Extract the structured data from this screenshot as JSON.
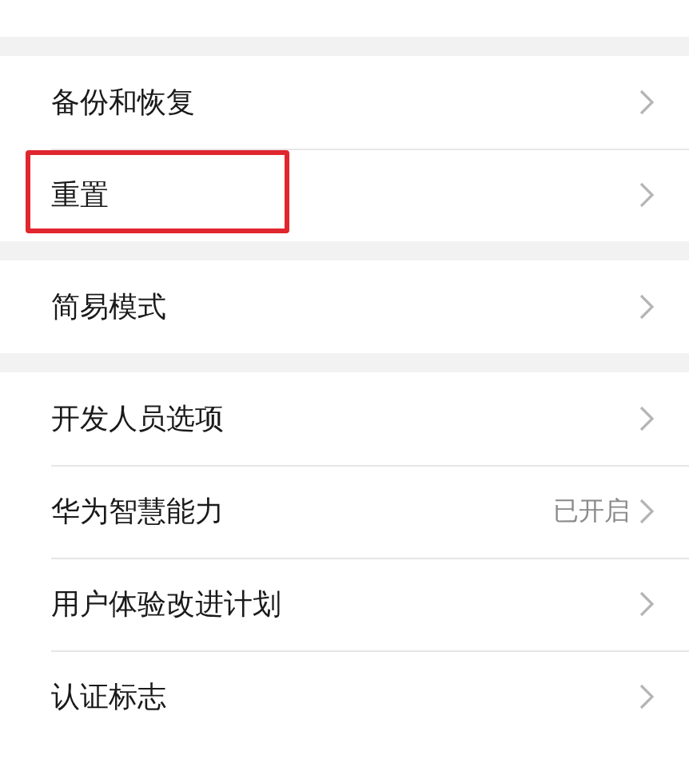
{
  "sections": [
    {
      "items": [
        {
          "label": "备份和恢复",
          "highlighted": false
        },
        {
          "label": "重置",
          "highlighted": true
        }
      ]
    },
    {
      "items": [
        {
          "label": "简易模式",
          "highlighted": false
        }
      ]
    },
    {
      "items": [
        {
          "label": "开发人员选项",
          "highlighted": false
        },
        {
          "label": "华为智慧能力",
          "value": "已开启",
          "highlighted": false
        },
        {
          "label": "用户体验改进计划",
          "highlighted": false
        },
        {
          "label": "认证标志",
          "highlighted": false
        }
      ]
    }
  ]
}
